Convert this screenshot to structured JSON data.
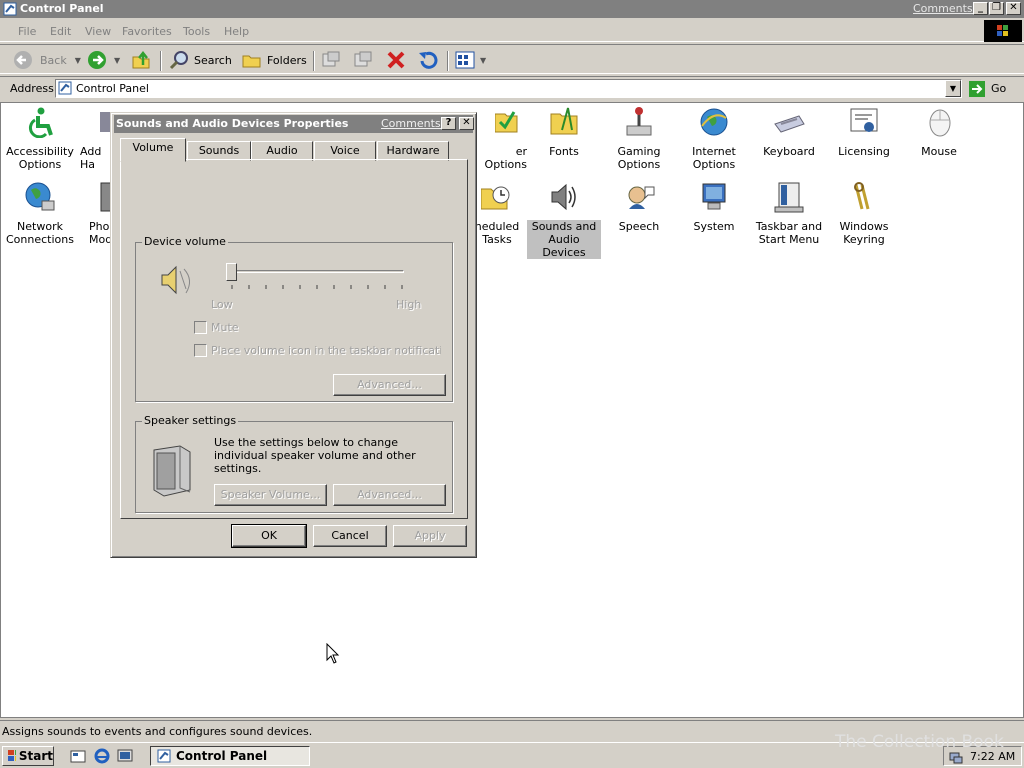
{
  "window": {
    "title": "Control Panel",
    "comments_link": "Comments?"
  },
  "menu": {
    "items": [
      "File",
      "Edit",
      "View",
      "Favorites",
      "Tools",
      "Help"
    ]
  },
  "toolbar": {
    "back_label": "Back",
    "search_label": "Search",
    "folders_label": "Folders"
  },
  "address": {
    "label": "Address",
    "value": "Control Panel",
    "go_label": "Go"
  },
  "icons": [
    {
      "label": "Accessibility Options"
    },
    {
      "label": "Add Ha"
    },
    {
      "label": "er Options"
    },
    {
      "label": "Fonts"
    },
    {
      "label": "Gaming Options"
    },
    {
      "label": "Internet Options"
    },
    {
      "label": "Keyboard"
    },
    {
      "label": "Licensing"
    },
    {
      "label": "Mouse"
    },
    {
      "label": "Network Connections"
    },
    {
      "label": "Phon Mod"
    },
    {
      "label": "heduled Tasks"
    },
    {
      "label": "Sounds and Audio Devices"
    },
    {
      "label": "Speech"
    },
    {
      "label": "System"
    },
    {
      "label": "Taskbar and Start Menu"
    },
    {
      "label": "Windows Keyring"
    }
  ],
  "dialog": {
    "title": "Sounds and Audio Devices Properties",
    "comments_link": "Comments?",
    "tabs": [
      "Volume",
      "Sounds",
      "Audio",
      "Voice",
      "Hardware"
    ],
    "active_tab": "Volume",
    "device_volume": {
      "group_label": "Device volume",
      "low_label": "Low",
      "high_label": "High",
      "level": 0,
      "mute_label": "Mute",
      "tray_icon_label": "Place volume icon in the taskbar notification area",
      "advanced_label": "Advanced..."
    },
    "speaker_settings": {
      "group_label": "Speaker settings",
      "description": "Use the settings below to change individual speaker volume and other settings.",
      "speaker_volume_label": "Speaker Volume...",
      "advanced_label": "Advanced..."
    },
    "ok_label": "OK",
    "cancel_label": "Cancel",
    "apply_label": "Apply"
  },
  "status": {
    "text": "Assigns sounds to events and configures sound devices."
  },
  "taskbar": {
    "start_label": "Start",
    "task_label": "Control Panel",
    "clock": "7:22 AM"
  },
  "watermark": "The Collection Book"
}
